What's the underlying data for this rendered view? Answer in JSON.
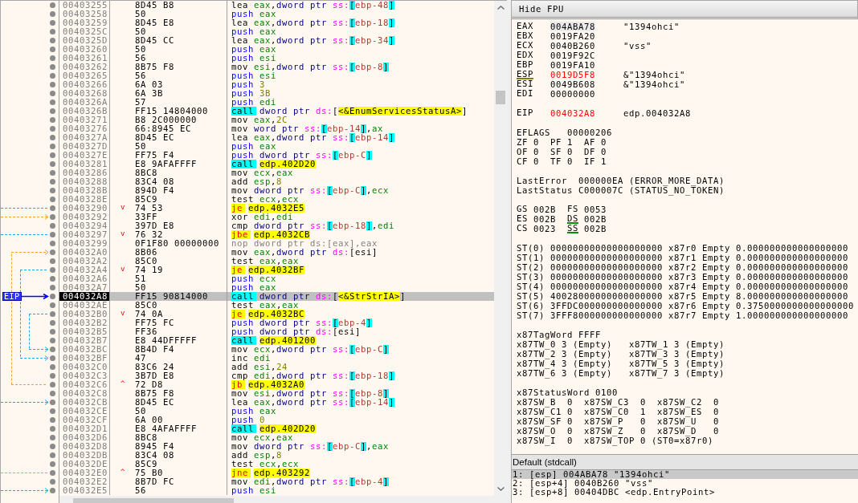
{
  "disassembly": {
    "eip_label": "EIP",
    "rows": [
      {
        "address": "00403255",
        "bytes": "8D45 B8",
        "selected": false,
        "current": false,
        "parts": [
          {
            "kind": "op",
            "text": "lea "
          },
          {
            "kind": "reg",
            "text": "eax"
          },
          {
            "kind": "plain",
            "text": ","
          },
          {
            "kind": "size",
            "text": "dword ptr "
          },
          {
            "kind": "seg",
            "text": "ss:"
          },
          {
            "kind": "bracket",
            "text": "["
          },
          {
            "kind": "stack",
            "text": "ebp-48"
          },
          {
            "kind": "bracket",
            "text": "]"
          }
        ]
      },
      {
        "address": "00403258",
        "bytes": "50",
        "selected": false,
        "current": false,
        "parts": [
          {
            "kind": "push",
            "text": "push "
          },
          {
            "kind": "reg",
            "text": "eax"
          }
        ]
      },
      {
        "address": "00403259",
        "bytes": "8D45 E8",
        "selected": false,
        "current": false,
        "parts": [
          {
            "kind": "op",
            "text": "lea "
          },
          {
            "kind": "reg",
            "text": "eax"
          },
          {
            "kind": "plain",
            "text": ","
          },
          {
            "kind": "size",
            "text": "dword ptr "
          },
          {
            "kind": "seg",
            "text": "ss:"
          },
          {
            "kind": "bracket",
            "text": "["
          },
          {
            "kind": "stack",
            "text": "ebp-18"
          },
          {
            "kind": "bracket",
            "text": "]"
          }
        ]
      },
      {
        "address": "0040325C",
        "bytes": "50",
        "selected": false,
        "current": false,
        "parts": [
          {
            "kind": "push",
            "text": "push "
          },
          {
            "kind": "reg",
            "text": "eax"
          }
        ]
      },
      {
        "address": "0040325D",
        "bytes": "8D45 CC",
        "selected": false,
        "current": false,
        "parts": [
          {
            "kind": "op",
            "text": "lea "
          },
          {
            "kind": "reg",
            "text": "eax"
          },
          {
            "kind": "plain",
            "text": ","
          },
          {
            "kind": "size",
            "text": "dword ptr "
          },
          {
            "kind": "seg",
            "text": "ss:"
          },
          {
            "kind": "bracket",
            "text": "["
          },
          {
            "kind": "stack",
            "text": "ebp-34"
          },
          {
            "kind": "bracket",
            "text": "]"
          }
        ]
      },
      {
        "address": "00403260",
        "bytes": "50",
        "selected": false,
        "current": false,
        "parts": [
          {
            "kind": "push",
            "text": "push "
          },
          {
            "kind": "reg",
            "text": "eax"
          }
        ]
      },
      {
        "address": "00403261",
        "bytes": "56",
        "selected": false,
        "current": false,
        "parts": [
          {
            "kind": "push",
            "text": "push "
          },
          {
            "kind": "reg",
            "text": "esi"
          }
        ]
      },
      {
        "address": "00403262",
        "bytes": "8B75 F8",
        "selected": false,
        "current": false,
        "parts": [
          {
            "kind": "op",
            "text": "mov "
          },
          {
            "kind": "reg",
            "text": "esi"
          },
          {
            "kind": "plain",
            "text": ","
          },
          {
            "kind": "size",
            "text": "dword ptr "
          },
          {
            "kind": "seg",
            "text": "ss:"
          },
          {
            "kind": "bracket",
            "text": "["
          },
          {
            "kind": "stack",
            "text": "ebp-8"
          },
          {
            "kind": "bracket",
            "text": "]"
          }
        ]
      },
      {
        "address": "00403265",
        "bytes": "56",
        "selected": false,
        "current": false,
        "parts": [
          {
            "kind": "push",
            "text": "push "
          },
          {
            "kind": "reg",
            "text": "esi"
          }
        ]
      },
      {
        "address": "00403266",
        "bytes": "6A 03",
        "selected": false,
        "current": false,
        "parts": [
          {
            "kind": "push",
            "text": "push "
          },
          {
            "kind": "imm",
            "text": "3"
          }
        ]
      },
      {
        "address": "00403268",
        "bytes": "6A 3B",
        "selected": false,
        "current": false,
        "parts": [
          {
            "kind": "push",
            "text": "push "
          },
          {
            "kind": "imm",
            "text": "3B"
          }
        ]
      },
      {
        "address": "0040326A",
        "bytes": "57",
        "selected": false,
        "current": false,
        "parts": [
          {
            "kind": "push",
            "text": "push "
          },
          {
            "kind": "reg",
            "text": "edi"
          }
        ]
      },
      {
        "address": "0040326B",
        "bytes": "FF15 14804000",
        "selected": false,
        "current": false,
        "parts": [
          {
            "kind": "call",
            "text": "call "
          },
          {
            "kind": "size",
            "text": "dword ptr "
          },
          {
            "kind": "seg",
            "text": "ds:"
          },
          {
            "kind": "plain",
            "text": "["
          },
          {
            "kind": "target",
            "text": "<&EnumServicesStatusA>"
          },
          {
            "kind": "plain",
            "text": "]"
          }
        ]
      },
      {
        "address": "00403271",
        "bytes": "B8 2C000000",
        "selected": false,
        "current": false,
        "parts": [
          {
            "kind": "op",
            "text": "mov "
          },
          {
            "kind": "reg",
            "text": "eax"
          },
          {
            "kind": "plain",
            "text": ","
          },
          {
            "kind": "imm",
            "text": "2C"
          }
        ]
      },
      {
        "address": "00403276",
        "bytes": "66:8945 EC",
        "selected": false,
        "current": false,
        "parts": [
          {
            "kind": "op",
            "text": "mov "
          },
          {
            "kind": "size",
            "text": "word ptr "
          },
          {
            "kind": "seg",
            "text": "ss:"
          },
          {
            "kind": "bracket",
            "text": "["
          },
          {
            "kind": "stack",
            "text": "ebp-14"
          },
          {
            "kind": "bracket",
            "text": "]"
          },
          {
            "kind": "plain",
            "text": ","
          },
          {
            "kind": "reg",
            "text": "ax"
          }
        ]
      },
      {
        "address": "0040327A",
        "bytes": "8D45 EC",
        "selected": false,
        "current": false,
        "parts": [
          {
            "kind": "op",
            "text": "lea "
          },
          {
            "kind": "reg",
            "text": "eax"
          },
          {
            "kind": "plain",
            "text": ","
          },
          {
            "kind": "size",
            "text": "dword ptr "
          },
          {
            "kind": "seg",
            "text": "ss:"
          },
          {
            "kind": "bracket",
            "text": "["
          },
          {
            "kind": "stack",
            "text": "ebp-14"
          },
          {
            "kind": "bracket",
            "text": "]"
          }
        ]
      },
      {
        "address": "0040327D",
        "bytes": "50",
        "selected": false,
        "current": false,
        "parts": [
          {
            "kind": "push",
            "text": "push "
          },
          {
            "kind": "reg",
            "text": "eax"
          }
        ]
      },
      {
        "address": "0040327E",
        "bytes": "FF75 F4",
        "selected": false,
        "current": false,
        "parts": [
          {
            "kind": "push",
            "text": "push "
          },
          {
            "kind": "size",
            "text": "dword ptr "
          },
          {
            "kind": "seg",
            "text": "ss:"
          },
          {
            "kind": "bracket",
            "text": "["
          },
          {
            "kind": "stack",
            "text": "ebp-C"
          },
          {
            "kind": "bracket",
            "text": "]"
          }
        ]
      },
      {
        "address": "00403281",
        "bytes": "E8 9AFAFFFF",
        "selected": false,
        "current": false,
        "parts": [
          {
            "kind": "call",
            "text": "call "
          },
          {
            "kind": "target",
            "text": "edp.402D20"
          }
        ]
      },
      {
        "address": "00403286",
        "bytes": "8BC8",
        "selected": false,
        "current": false,
        "parts": [
          {
            "kind": "op",
            "text": "mov "
          },
          {
            "kind": "reg",
            "text": "ecx"
          },
          {
            "kind": "plain",
            "text": ","
          },
          {
            "kind": "reg",
            "text": "eax"
          }
        ]
      },
      {
        "address": "00403288",
        "bytes": "83C4 08",
        "selected": false,
        "current": false,
        "parts": [
          {
            "kind": "op",
            "text": "add "
          },
          {
            "kind": "reg",
            "text": "esp"
          },
          {
            "kind": "plain",
            "text": ","
          },
          {
            "kind": "imm",
            "text": "8"
          }
        ]
      },
      {
        "address": "0040328B",
        "bytes": "894D F4",
        "selected": false,
        "current": false,
        "parts": [
          {
            "kind": "op",
            "text": "mov "
          },
          {
            "kind": "size",
            "text": "dword ptr "
          },
          {
            "kind": "seg",
            "text": "ss:"
          },
          {
            "kind": "bracket",
            "text": "["
          },
          {
            "kind": "stack",
            "text": "ebp-C"
          },
          {
            "kind": "bracket",
            "text": "]"
          },
          {
            "kind": "plain",
            "text": ","
          },
          {
            "kind": "reg",
            "text": "ecx"
          }
        ]
      },
      {
        "address": "0040328E",
        "bytes": "85C9",
        "selected": false,
        "current": false,
        "parts": [
          {
            "kind": "op",
            "text": "test "
          },
          {
            "kind": "reg",
            "text": "ecx"
          },
          {
            "kind": "plain",
            "text": ","
          },
          {
            "kind": "reg",
            "text": "ecx"
          }
        ]
      },
      {
        "address": "00403290",
        "bytes": "74 53",
        "selected": false,
        "current": false,
        "jump_mark": "v",
        "parts": [
          {
            "kind": "jump",
            "text": "je "
          },
          {
            "kind": "target",
            "text": "edp.4032E5"
          }
        ]
      },
      {
        "address": "00403292",
        "bytes": "33FF",
        "selected": false,
        "current": false,
        "parts": [
          {
            "kind": "op",
            "text": "xor "
          },
          {
            "kind": "reg",
            "text": "edi"
          },
          {
            "kind": "plain",
            "text": ","
          },
          {
            "kind": "reg",
            "text": "edi"
          }
        ]
      },
      {
        "address": "00403294",
        "bytes": "397D E8",
        "selected": false,
        "current": false,
        "parts": [
          {
            "kind": "op",
            "text": "cmp "
          },
          {
            "kind": "size",
            "text": "dword ptr "
          },
          {
            "kind": "seg",
            "text": "ss:"
          },
          {
            "kind": "bracket",
            "text": "["
          },
          {
            "kind": "stack",
            "text": "ebp-18"
          },
          {
            "kind": "bracket",
            "text": "]"
          },
          {
            "kind": "plain",
            "text": ","
          },
          {
            "kind": "reg",
            "text": "edi"
          }
        ]
      },
      {
        "address": "00403297",
        "bytes": "76 32",
        "selected": false,
        "current": false,
        "jump_mark": "v",
        "parts": [
          {
            "kind": "jump",
            "text": "jbe "
          },
          {
            "kind": "target",
            "text": "edp.4032CB"
          }
        ]
      },
      {
        "address": "00403299",
        "bytes": "0F1F80 00000000",
        "selected": false,
        "current": false,
        "parts": [
          {
            "kind": "muted",
            "text": "nop dword ptr ds:[eax],eax"
          }
        ]
      },
      {
        "address": "004032A0",
        "bytes": "8B06",
        "selected": false,
        "current": false,
        "parts": [
          {
            "kind": "op",
            "text": "mov "
          },
          {
            "kind": "reg",
            "text": "eax"
          },
          {
            "kind": "plain",
            "text": ","
          },
          {
            "kind": "size",
            "text": "dword ptr "
          },
          {
            "kind": "seg",
            "text": "ds:"
          },
          {
            "kind": "plain",
            "text": "[esi]"
          }
        ]
      },
      {
        "address": "004032A2",
        "bytes": "85C0",
        "selected": false,
        "current": false,
        "parts": [
          {
            "kind": "op",
            "text": "test "
          },
          {
            "kind": "reg",
            "text": "eax"
          },
          {
            "kind": "plain",
            "text": ","
          },
          {
            "kind": "reg",
            "text": "eax"
          }
        ]
      },
      {
        "address": "004032A4",
        "bytes": "74 19",
        "selected": false,
        "current": false,
        "jump_mark": "v",
        "parts": [
          {
            "kind": "jump",
            "text": "je "
          },
          {
            "kind": "target",
            "text": "edp.4032BF"
          }
        ]
      },
      {
        "address": "004032A6",
        "bytes": "51",
        "selected": false,
        "current": false,
        "parts": [
          {
            "kind": "push",
            "text": "push "
          },
          {
            "kind": "reg",
            "text": "ecx"
          }
        ]
      },
      {
        "address": "004032A7",
        "bytes": "50",
        "selected": false,
        "current": false,
        "parts": [
          {
            "kind": "push",
            "text": "push "
          },
          {
            "kind": "reg",
            "text": "eax"
          }
        ]
      },
      {
        "address": "004032A8",
        "bytes": "FF15 90814000",
        "selected": true,
        "current": true,
        "parts": [
          {
            "kind": "call",
            "text": "call "
          },
          {
            "kind": "size",
            "text": "dword ptr "
          },
          {
            "kind": "seg",
            "text": "ds:"
          },
          {
            "kind": "plain",
            "text": "["
          },
          {
            "kind": "target",
            "text": "<&StrStrIA>"
          },
          {
            "kind": "plain",
            "text": "]"
          }
        ]
      },
      {
        "address": "004032AE",
        "bytes": "85C0",
        "selected": false,
        "current": false,
        "parts": [
          {
            "kind": "op",
            "text": "test "
          },
          {
            "kind": "reg",
            "text": "eax"
          },
          {
            "kind": "plain",
            "text": ","
          },
          {
            "kind": "reg",
            "text": "eax"
          }
        ]
      },
      {
        "address": "004032B0",
        "bytes": "74 0A",
        "selected": false,
        "current": false,
        "jump_mark": "v",
        "parts": [
          {
            "kind": "jump",
            "text": "je "
          },
          {
            "kind": "target",
            "text": "edp.4032BC"
          }
        ]
      },
      {
        "address": "004032B2",
        "bytes": "FF75 FC",
        "selected": false,
        "current": false,
        "parts": [
          {
            "kind": "push",
            "text": "push "
          },
          {
            "kind": "size",
            "text": "dword ptr "
          },
          {
            "kind": "seg",
            "text": "ss:"
          },
          {
            "kind": "bracket",
            "text": "["
          },
          {
            "kind": "stack",
            "text": "ebp-4"
          },
          {
            "kind": "bracket",
            "text": "]"
          }
        ]
      },
      {
        "address": "004032B5",
        "bytes": "FF36",
        "selected": false,
        "current": false,
        "parts": [
          {
            "kind": "push",
            "text": "push "
          },
          {
            "kind": "size",
            "text": "dword ptr "
          },
          {
            "kind": "seg",
            "text": "ds:"
          },
          {
            "kind": "plain",
            "text": "[esi]"
          }
        ]
      },
      {
        "address": "004032B7",
        "bytes": "E8 44DFFFFF",
        "selected": false,
        "current": false,
        "parts": [
          {
            "kind": "call",
            "text": "call "
          },
          {
            "kind": "target",
            "text": "edp.401200"
          }
        ]
      },
      {
        "address": "004032BC",
        "bytes": "8B4D F4",
        "selected": false,
        "current": false,
        "parts": [
          {
            "kind": "op",
            "text": "mov "
          },
          {
            "kind": "reg",
            "text": "ecx"
          },
          {
            "kind": "plain",
            "text": ","
          },
          {
            "kind": "size",
            "text": "dword ptr "
          },
          {
            "kind": "seg",
            "text": "ss:"
          },
          {
            "kind": "bracket",
            "text": "["
          },
          {
            "kind": "stack",
            "text": "ebp-C"
          },
          {
            "kind": "bracket",
            "text": "]"
          }
        ]
      },
      {
        "address": "004032BF",
        "bytes": "47",
        "selected": false,
        "current": false,
        "parts": [
          {
            "kind": "op",
            "text": "inc "
          },
          {
            "kind": "reg",
            "text": "edi"
          }
        ]
      },
      {
        "address": "004032C0",
        "bytes": "83C6 24",
        "selected": false,
        "current": false,
        "parts": [
          {
            "kind": "op",
            "text": "add "
          },
          {
            "kind": "reg",
            "text": "esi"
          },
          {
            "kind": "plain",
            "text": ","
          },
          {
            "kind": "imm",
            "text": "24"
          }
        ]
      },
      {
        "address": "004032C3",
        "bytes": "3B7D E8",
        "selected": false,
        "current": false,
        "parts": [
          {
            "kind": "op",
            "text": "cmp "
          },
          {
            "kind": "reg",
            "text": "edi"
          },
          {
            "kind": "plain",
            "text": ","
          },
          {
            "kind": "size",
            "text": "dword ptr "
          },
          {
            "kind": "seg",
            "text": "ss:"
          },
          {
            "kind": "bracket",
            "text": "["
          },
          {
            "kind": "stack",
            "text": "ebp-18"
          },
          {
            "kind": "bracket",
            "text": "]"
          }
        ]
      },
      {
        "address": "004032C6",
        "bytes": "72 D8",
        "selected": false,
        "current": false,
        "jump_mark": "^",
        "parts": [
          {
            "kind": "jump",
            "text": "jb "
          },
          {
            "kind": "target",
            "text": "edp.4032A0"
          }
        ]
      },
      {
        "address": "004032C8",
        "bytes": "8B75 F8",
        "selected": false,
        "current": false,
        "parts": [
          {
            "kind": "op",
            "text": "mov "
          },
          {
            "kind": "reg",
            "text": "esi"
          },
          {
            "kind": "plain",
            "text": ","
          },
          {
            "kind": "size",
            "text": "dword ptr "
          },
          {
            "kind": "seg",
            "text": "ss:"
          },
          {
            "kind": "bracket",
            "text": "["
          },
          {
            "kind": "stack",
            "text": "ebp-8"
          },
          {
            "kind": "bracket",
            "text": "]"
          }
        ]
      },
      {
        "address": "004032CB",
        "bytes": "8D45 EC",
        "selected": false,
        "current": false,
        "parts": [
          {
            "kind": "op",
            "text": "lea "
          },
          {
            "kind": "reg",
            "text": "eax"
          },
          {
            "kind": "plain",
            "text": ","
          },
          {
            "kind": "size",
            "text": "dword ptr "
          },
          {
            "kind": "seg",
            "text": "ss:"
          },
          {
            "kind": "bracket",
            "text": "["
          },
          {
            "kind": "stack",
            "text": "ebp-14"
          },
          {
            "kind": "bracket",
            "text": "]"
          }
        ]
      },
      {
        "address": "004032CE",
        "bytes": "50",
        "selected": false,
        "current": false,
        "parts": [
          {
            "kind": "push",
            "text": "push "
          },
          {
            "kind": "reg",
            "text": "eax"
          }
        ]
      },
      {
        "address": "004032CF",
        "bytes": "6A 00",
        "selected": false,
        "current": false,
        "parts": [
          {
            "kind": "push",
            "text": "push "
          },
          {
            "kind": "imm",
            "text": "0"
          }
        ]
      },
      {
        "address": "004032D1",
        "bytes": "E8 4AFAFFFF",
        "selected": false,
        "current": false,
        "parts": [
          {
            "kind": "call",
            "text": "call "
          },
          {
            "kind": "target",
            "text": "edp.402D20"
          }
        ]
      },
      {
        "address": "004032D6",
        "bytes": "8BC8",
        "selected": false,
        "current": false,
        "parts": [
          {
            "kind": "op",
            "text": "mov "
          },
          {
            "kind": "reg",
            "text": "ecx"
          },
          {
            "kind": "plain",
            "text": ","
          },
          {
            "kind": "reg",
            "text": "eax"
          }
        ]
      },
      {
        "address": "004032D8",
        "bytes": "8945 F4",
        "selected": false,
        "current": false,
        "parts": [
          {
            "kind": "op",
            "text": "mov "
          },
          {
            "kind": "size",
            "text": "dword ptr "
          },
          {
            "kind": "seg",
            "text": "ss:"
          },
          {
            "kind": "bracket",
            "text": "["
          },
          {
            "kind": "stack",
            "text": "ebp-C"
          },
          {
            "kind": "bracket",
            "text": "]"
          },
          {
            "kind": "plain",
            "text": ","
          },
          {
            "kind": "reg",
            "text": "eax"
          }
        ]
      },
      {
        "address": "004032DB",
        "bytes": "83C4 08",
        "selected": false,
        "current": false,
        "parts": [
          {
            "kind": "op",
            "text": "add "
          },
          {
            "kind": "reg",
            "text": "esp"
          },
          {
            "kind": "plain",
            "text": ","
          },
          {
            "kind": "imm",
            "text": "8"
          }
        ]
      },
      {
        "address": "004032DE",
        "bytes": "85C9",
        "selected": false,
        "current": false,
        "parts": [
          {
            "kind": "op",
            "text": "test "
          },
          {
            "kind": "reg",
            "text": "ecx"
          },
          {
            "kind": "plain",
            "text": ","
          },
          {
            "kind": "reg",
            "text": "ecx"
          }
        ]
      },
      {
        "address": "004032E0",
        "bytes": "75 B0",
        "selected": false,
        "current": false,
        "jump_mark": "^",
        "parts": [
          {
            "kind": "jump",
            "text": "jne "
          },
          {
            "kind": "target",
            "text": "edp.403292"
          }
        ]
      },
      {
        "address": "004032E2",
        "bytes": "8B7D FC",
        "selected": false,
        "current": false,
        "parts": [
          {
            "kind": "op",
            "text": "mov "
          },
          {
            "kind": "reg",
            "text": "edi"
          },
          {
            "kind": "plain",
            "text": ","
          },
          {
            "kind": "size",
            "text": "dword ptr "
          },
          {
            "kind": "seg",
            "text": "ss:"
          },
          {
            "kind": "bracket",
            "text": "["
          },
          {
            "kind": "stack",
            "text": "ebp-4"
          },
          {
            "kind": "bracket",
            "text": "]"
          }
        ]
      },
      {
        "address": "004032E5",
        "bytes": "56",
        "selected": false,
        "current": false,
        "parts": [
          {
            "kind": "push",
            "text": "push "
          },
          {
            "kind": "reg",
            "text": "esi"
          }
        ]
      }
    ]
  },
  "registers": {
    "toggle_button": "Hide FPU",
    "general": [
      {
        "name": "EAX",
        "value": "004ABA78",
        "comment": "\"1394ohci\"",
        "selected": true,
        "modified": false,
        "underlined": false
      },
      {
        "name": "EBX",
        "value": "0019FA20",
        "selected": false,
        "modified": false,
        "underlined": false
      },
      {
        "name": "ECX",
        "value": "0040B260",
        "comment": "\"vss\"",
        "selected": false,
        "modified": false,
        "underlined": false
      },
      {
        "name": "EDX",
        "value": "0019F92C",
        "selected": false,
        "modified": false,
        "underlined": false
      },
      {
        "name": "EBP",
        "value": "0019FA10",
        "selected": false,
        "modified": false,
        "underlined": false
      },
      {
        "name": "ESP",
        "value": "0019D5F8",
        "comment": "&\"1394ohci\"",
        "selected": false,
        "modified": true,
        "underlined": true
      },
      {
        "name": "ESI",
        "value": "0049B608",
        "comment": "&\"1394ohci\"",
        "selected": false,
        "modified": false,
        "underlined": false
      },
      {
        "name": "EDI",
        "value": "00000000",
        "selected": false,
        "modified": false,
        "underlined": false
      }
    ],
    "pointer": [
      {
        "name": "EIP",
        "value": "004032A8",
        "comment": "edp.004032A8",
        "selected": false,
        "modified": true,
        "underlined": false
      }
    ],
    "eflags": {
      "name": "EFLAGS",
      "value": "00000206",
      "flags": [
        {
          "name": "ZF",
          "value": "0"
        },
        {
          "name": "PF",
          "value": "1"
        },
        {
          "name": "AF",
          "value": "0"
        },
        {
          "name": "OF",
          "value": "0"
        },
        {
          "name": "SF",
          "value": "0"
        },
        {
          "name": "DF",
          "value": "0"
        },
        {
          "name": "CF",
          "value": "0"
        },
        {
          "name": "TF",
          "value": "0"
        },
        {
          "name": "IF",
          "value": "1"
        }
      ]
    },
    "last_error": [
      {
        "name": "LastError",
        "value": "000000EA",
        "description": "(ERROR_MORE_DATA)"
      },
      {
        "name": "LastStatus",
        "value": "C000007C",
        "description": "(STATUS_NO_TOKEN)"
      }
    ],
    "segments": [
      {
        "name": "GS",
        "value": "002B",
        "underlined": false
      },
      {
        "name": "FS",
        "value": "0053",
        "underlined": false
      },
      {
        "name": "ES",
        "value": "002B",
        "underlined": false
      },
      {
        "name": "DS",
        "value": "002B",
        "underlined": true
      },
      {
        "name": "CS",
        "value": "0023",
        "underlined": false
      },
      {
        "name": "SS",
        "value": "002B",
        "underlined": true
      }
    ],
    "fpu_stack": [
      {
        "name": "ST(0)",
        "raw": "00000000000000000000",
        "register": "x87r0",
        "tag": "Empty",
        "value": "0.000000000000000000"
      },
      {
        "name": "ST(1)",
        "raw": "00000000000000000000",
        "register": "x87r1",
        "tag": "Empty",
        "value": "0.000000000000000000"
      },
      {
        "name": "ST(2)",
        "raw": "00000000000000000000",
        "register": "x87r2",
        "tag": "Empty",
        "value": "0.000000000000000000"
      },
      {
        "name": "ST(3)",
        "raw": "00000000000000000000",
        "register": "x87r3",
        "tag": "Empty",
        "value": "0.000000000000000000"
      },
      {
        "name": "ST(4)",
        "raw": "00000000000000000000",
        "register": "x87r4",
        "tag": "Empty",
        "value": "0.000000000000000000"
      },
      {
        "name": "ST(5)",
        "raw": "40028000000000000000",
        "register": "x87r5",
        "tag": "Empty",
        "value": "8.000000000000000000"
      },
      {
        "name": "ST(6)",
        "raw": "3FFDC000000000000000",
        "register": "x87r6",
        "tag": "Empty",
        "value": "0.3750000000000000000"
      },
      {
        "name": "ST(7)",
        "raw": "3FFF8000000000000000",
        "register": "x87r7",
        "tag": "Empty",
        "value": "1.000000000000000000"
      }
    ],
    "tag_word": {
      "name": "x87TagWord",
      "value": "FFFF",
      "entries": [
        {
          "name": "x87TW_0",
          "value": "3",
          "description": "(Empty)"
        },
        {
          "name": "x87TW_1",
          "value": "3",
          "description": "(Empty)"
        },
        {
          "name": "x87TW_2",
          "value": "3",
          "description": "(Empty)"
        },
        {
          "name": "x87TW_3",
          "value": "3",
          "description": "(Empty)"
        },
        {
          "name": "x87TW_4",
          "value": "3",
          "description": "(Empty)"
        },
        {
          "name": "x87TW_5",
          "value": "3",
          "description": "(Empty)"
        },
        {
          "name": "x87TW_6",
          "value": "3",
          "description": "(Empty)"
        },
        {
          "name": "x87TW_7",
          "value": "3",
          "description": "(Empty)"
        }
      ]
    },
    "status_word": {
      "name": "x87StatusWord",
      "value": "0100",
      "entries": [
        {
          "name": "x87SW_B",
          "value": "0"
        },
        {
          "name": "x87SW_C3",
          "value": "0"
        },
        {
          "name": "x87SW_C2",
          "value": "0"
        },
        {
          "name": "x87SW_C1",
          "value": "0"
        },
        {
          "name": "x87SW_C0",
          "value": "1"
        },
        {
          "name": "x87SW_ES",
          "value": "0"
        },
        {
          "name": "x87SW_SF",
          "value": "0"
        },
        {
          "name": "x87SW_P",
          "value": "0"
        },
        {
          "name": "x87SW_U",
          "value": "0"
        },
        {
          "name": "x87SW_O",
          "value": "0"
        },
        {
          "name": "x87SW_Z",
          "value": "0"
        },
        {
          "name": "x87SW_D",
          "value": "0"
        },
        {
          "name": "x87SW_I",
          "value": "0"
        },
        {
          "name": "x87SW_TOP",
          "value": "0",
          "description": "(ST0=x87r0)"
        }
      ]
    }
  },
  "call_stack": {
    "convention": "Default (stdcall)",
    "rows": [
      {
        "slot": "1:",
        "location": "[esp]",
        "value": "004ABA78",
        "comment": "\"1394ohci\"",
        "selected": true
      },
      {
        "slot": "2:",
        "location": "[esp+4]",
        "value": "0040B260",
        "comment": "\"vss\"",
        "selected": false
      },
      {
        "slot": "3:",
        "location": "[esp+8]",
        "value": "00404DBC",
        "comment": "<edp.EntryPoint>",
        "selected": false
      }
    ]
  }
}
